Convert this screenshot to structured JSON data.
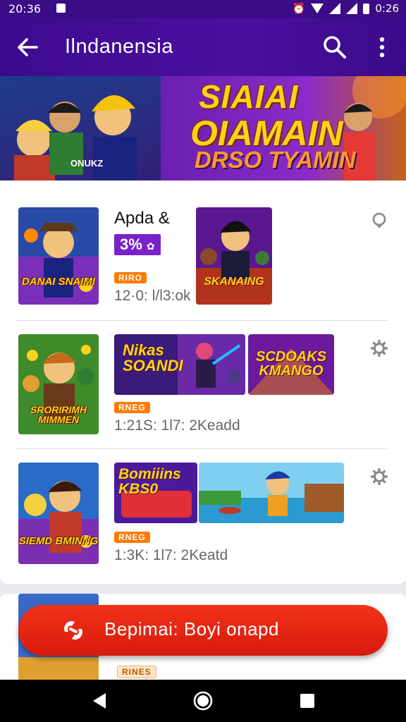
{
  "status_bar": {
    "time_left": "20:36",
    "time_right": "0:26"
  },
  "app_bar": {
    "title": "Ilndanensia",
    "back_icon": "arrow-left-icon",
    "search_icon": "search-icon",
    "more_icon": "more-vert-icon"
  },
  "banner": {
    "line1": "SIAIAI",
    "line2": "OIAMAIN",
    "line3": "DRSO TYAMIN",
    "tag": "ONUKZ"
  },
  "list": [
    {
      "title": "Apda &",
      "badge": "3%",
      "pill": "RIRO",
      "meta": "12·0: l/l3:ok",
      "thumb_caption": "DANAI SNAIMI",
      "shots": [
        {
          "caption": "SKANAING"
        }
      ],
      "icon": "location-pin-icon"
    },
    {
      "title": "",
      "badge": "",
      "pill": "RNEG",
      "meta": "1:21S: 1l7: 2Keadd",
      "thumb_caption": "SRORIRIMH MIMMEN",
      "shots": [
        {
          "caption": "Nikas SOANDI"
        },
        {
          "caption": "SCDOAKS KMANGO"
        }
      ],
      "icon": "gear-icon"
    },
    {
      "title": "",
      "badge": "",
      "pill": "RNEG",
      "meta": "1:3K: 1l7: 2Keatd",
      "thumb_caption": "SIEMD BMINNG",
      "shots": [
        {
          "caption": "Bomiiins KBS0"
        },
        {
          "caption": ""
        }
      ],
      "icon": "gear-icon"
    }
  ],
  "peek": {
    "pill": "RINES"
  },
  "cta": {
    "label": "Bepimai: Boyi onapd",
    "icon": "brand-logo-icon"
  },
  "nav": {
    "back": "nav-back-icon",
    "home": "nav-home-icon",
    "recents": "nav-recents-icon"
  },
  "colors": {
    "app_bar": "#3d0a8e",
    "cta": "#e5241a",
    "pill": "#ff7a00",
    "badge": "#7a22c9"
  }
}
